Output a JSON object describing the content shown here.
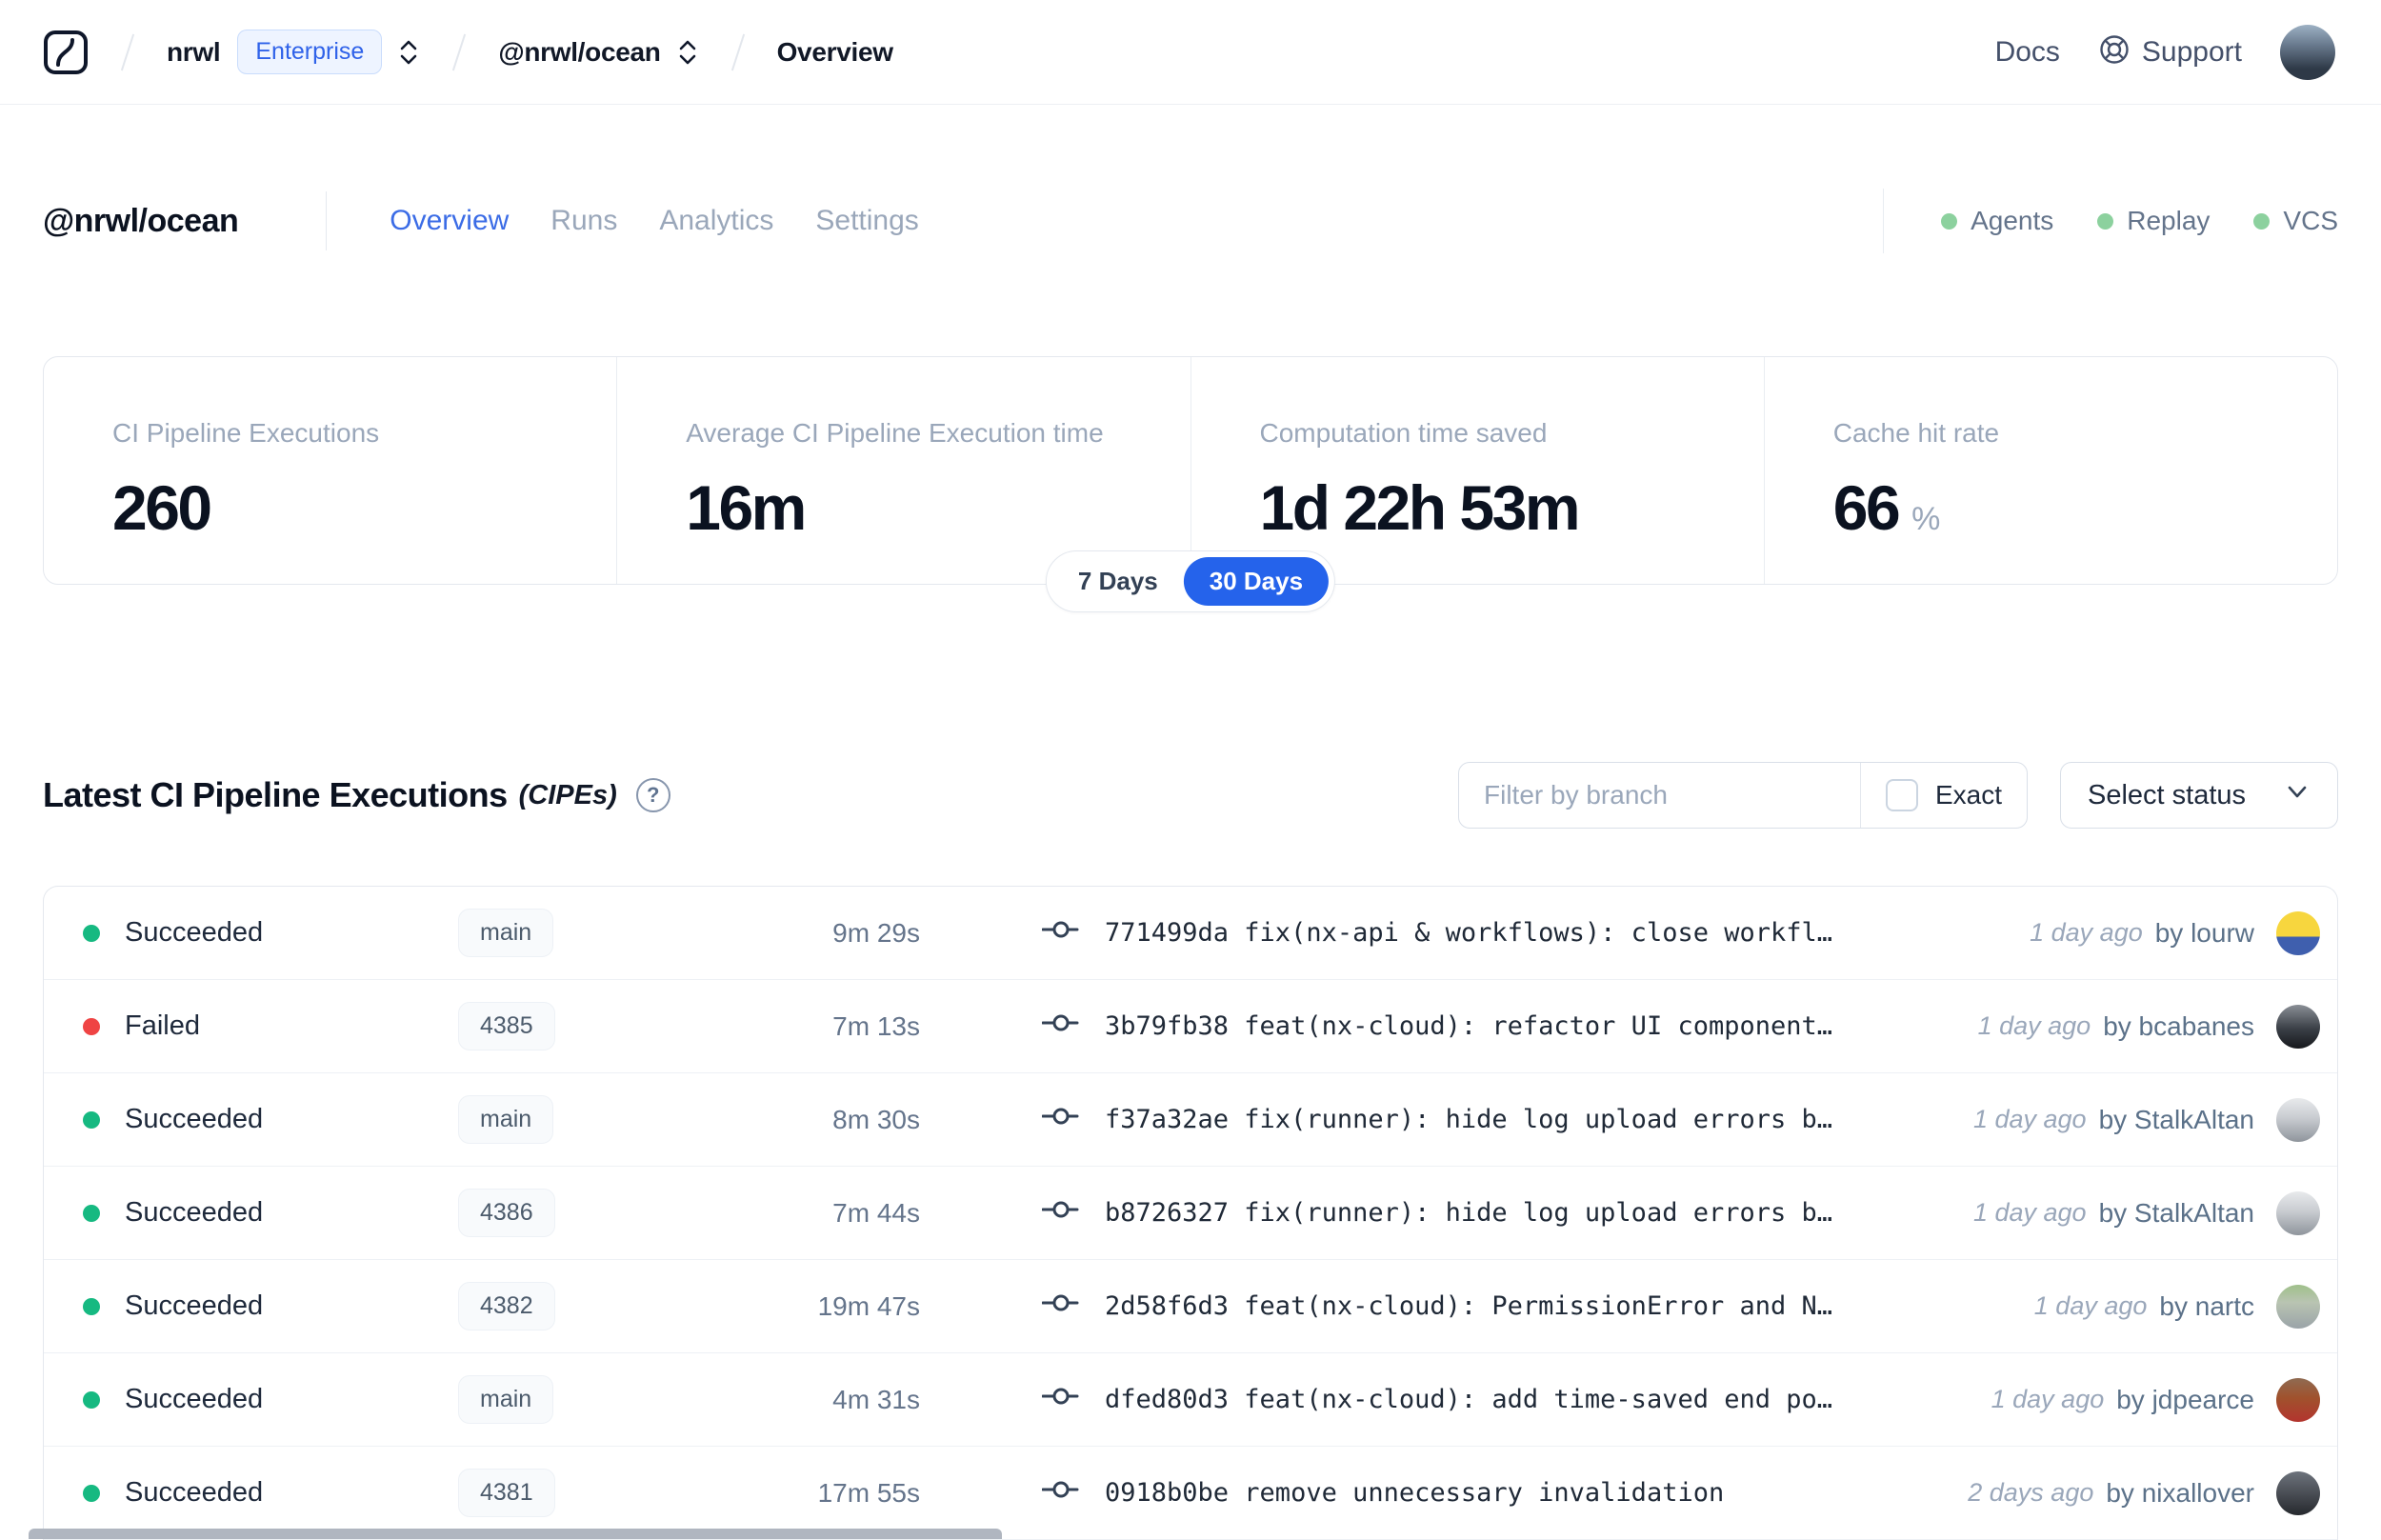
{
  "header": {
    "breadcrumb": {
      "org": "nrwl",
      "org_badge": "Enterprise",
      "workspace": "@nrwl/ocean",
      "page": "Overview"
    },
    "nav": {
      "docs": "Docs",
      "support": "Support"
    },
    "avatar_style": "background:linear-gradient(180deg,#9db1c4 0%,#6b7c90 35%,#2e3947 80%)"
  },
  "workspace": {
    "title": "@nrwl/ocean",
    "tabs": [
      {
        "label": "Overview",
        "active": true
      },
      {
        "label": "Runs",
        "active": false
      },
      {
        "label": "Analytics",
        "active": false
      },
      {
        "label": "Settings",
        "active": false
      }
    ],
    "status_indicators": [
      {
        "label": "Agents"
      },
      {
        "label": "Replay"
      },
      {
        "label": "VCS"
      }
    ],
    "indicator_color": "#8cd19e"
  },
  "stats": {
    "cards": [
      {
        "label": "CI Pipeline Executions",
        "value": "260",
        "suffix": ""
      },
      {
        "label": "Average CI Pipeline Execution time",
        "value": "16m",
        "suffix": ""
      },
      {
        "label": "Computation time saved",
        "value": "1d 22h 53m",
        "suffix": ""
      },
      {
        "label": "Cache hit rate",
        "value": "66",
        "suffix": "%"
      }
    ],
    "range_toggle": {
      "options": [
        "7 Days",
        "30 Days"
      ],
      "selected": "30 Days"
    }
  },
  "section": {
    "title": "Latest CI Pipeline Executions",
    "title_suffix": "(CIPEs)",
    "help_glyph": "?",
    "filter_placeholder": "Filter by branch",
    "exact_label": "Exact",
    "exact_checked": false,
    "status_select_label": "Select status"
  },
  "table": {
    "rows": [
      {
        "status": "Succeeded",
        "status_color": "#16b981",
        "branch": "main",
        "duration": "9m 29s",
        "commit": "771499da fix(nx-api & workflows): close workfl…",
        "time": "1 day ago",
        "author": "by lourw",
        "avatar_gradient": "linear-gradient(180deg,#f7d63e 0%,#f7d63e 58%,#3f5fae 58%,#3f5fae 100%)"
      },
      {
        "status": "Failed",
        "status_color": "#ef4444",
        "branch": "4385",
        "duration": "7m 13s",
        "commit": "3b79fb38 feat(nx-cloud): refactor UI component…",
        "time": "1 day ago",
        "author": "by bcabanes",
        "avatar_gradient": "linear-gradient(180deg,#8a8f96 0%,#3a3f46 55%,#17191d 100%)"
      },
      {
        "status": "Succeeded",
        "status_color": "#16b981",
        "branch": "main",
        "duration": "8m 30s",
        "commit": "f37a32ae fix(runner): hide log upload errors b…",
        "time": "1 day ago",
        "author": "by StalkAltan",
        "avatar_gradient": "linear-gradient(180deg,#e8eaec 0%,#c9ccd1 45%,#8f959c 100%)"
      },
      {
        "status": "Succeeded",
        "status_color": "#16b981",
        "branch": "4386",
        "duration": "7m 44s",
        "commit": "b8726327 fix(runner): hide log upload errors b…",
        "time": "1 day ago",
        "author": "by StalkAltan",
        "avatar_gradient": "linear-gradient(180deg,#e8eaec 0%,#c9ccd1 45%,#8f959c 100%)"
      },
      {
        "status": "Succeeded",
        "status_color": "#16b981",
        "branch": "4382",
        "duration": "19m 47s",
        "commit": "2d58f6d3 feat(nx-cloud): PermissionError and N…",
        "time": "1 day ago",
        "author": "by nartc",
        "avatar_gradient": "linear-gradient(180deg,#9fc08a 0%,#b9c4b2 40%,#9aa3a8 100%)"
      },
      {
        "status": "Succeeded",
        "status_color": "#16b981",
        "branch": "main",
        "duration": "4m 31s",
        "commit": "dfed80d3 feat(nx-cloud): add time-saved end po…",
        "time": "1 day ago",
        "author": "by jdpearce",
        "avatar_gradient": "linear-gradient(180deg,#8f6b52 0%,#a0522d 45%,#b3342e 100%)"
      },
      {
        "status": "Succeeded",
        "status_color": "#16b981",
        "branch": "4381",
        "duration": "17m 55s",
        "commit": "0918b0be remove unnecessary invalidation",
        "time": "2 days ago",
        "author": "by nixallover",
        "avatar_gradient": "linear-gradient(180deg,#6d737c 0%,#4a4e55 50%,#26292e 100%)"
      }
    ]
  },
  "colors": {
    "accent_blue": "#2563eb",
    "tab_active_blue": "#3b6ce6",
    "success_green": "#16b981",
    "failed_red": "#ef4444",
    "indicator_green": "#8cd19e",
    "muted_text": "#9aa7ba"
  },
  "icons": {
    "logo": "nx-cloud-logo",
    "breadcrumb_selector": "chevron-up-down-icon",
    "support": "life-ring-icon",
    "help": "question-circle-icon",
    "commit": "git-commit-icon",
    "select": "chevron-down-icon"
  }
}
